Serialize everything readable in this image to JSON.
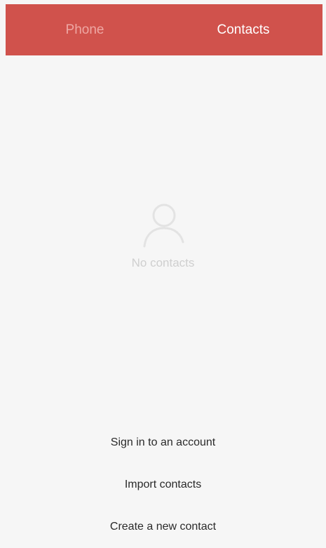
{
  "tabs": {
    "phone": "Phone",
    "contacts": "Contacts"
  },
  "empty_state": {
    "icon": "person-icon",
    "text": "No contacts"
  },
  "actions": {
    "sign_in": "Sign in to an account",
    "import": "Import contacts",
    "create": "Create a new contact"
  },
  "colors": {
    "accent": "#d0524c",
    "tab_inactive": "#eea7a3",
    "tab_active": "#ffffff",
    "background": "#f6f6f6"
  }
}
